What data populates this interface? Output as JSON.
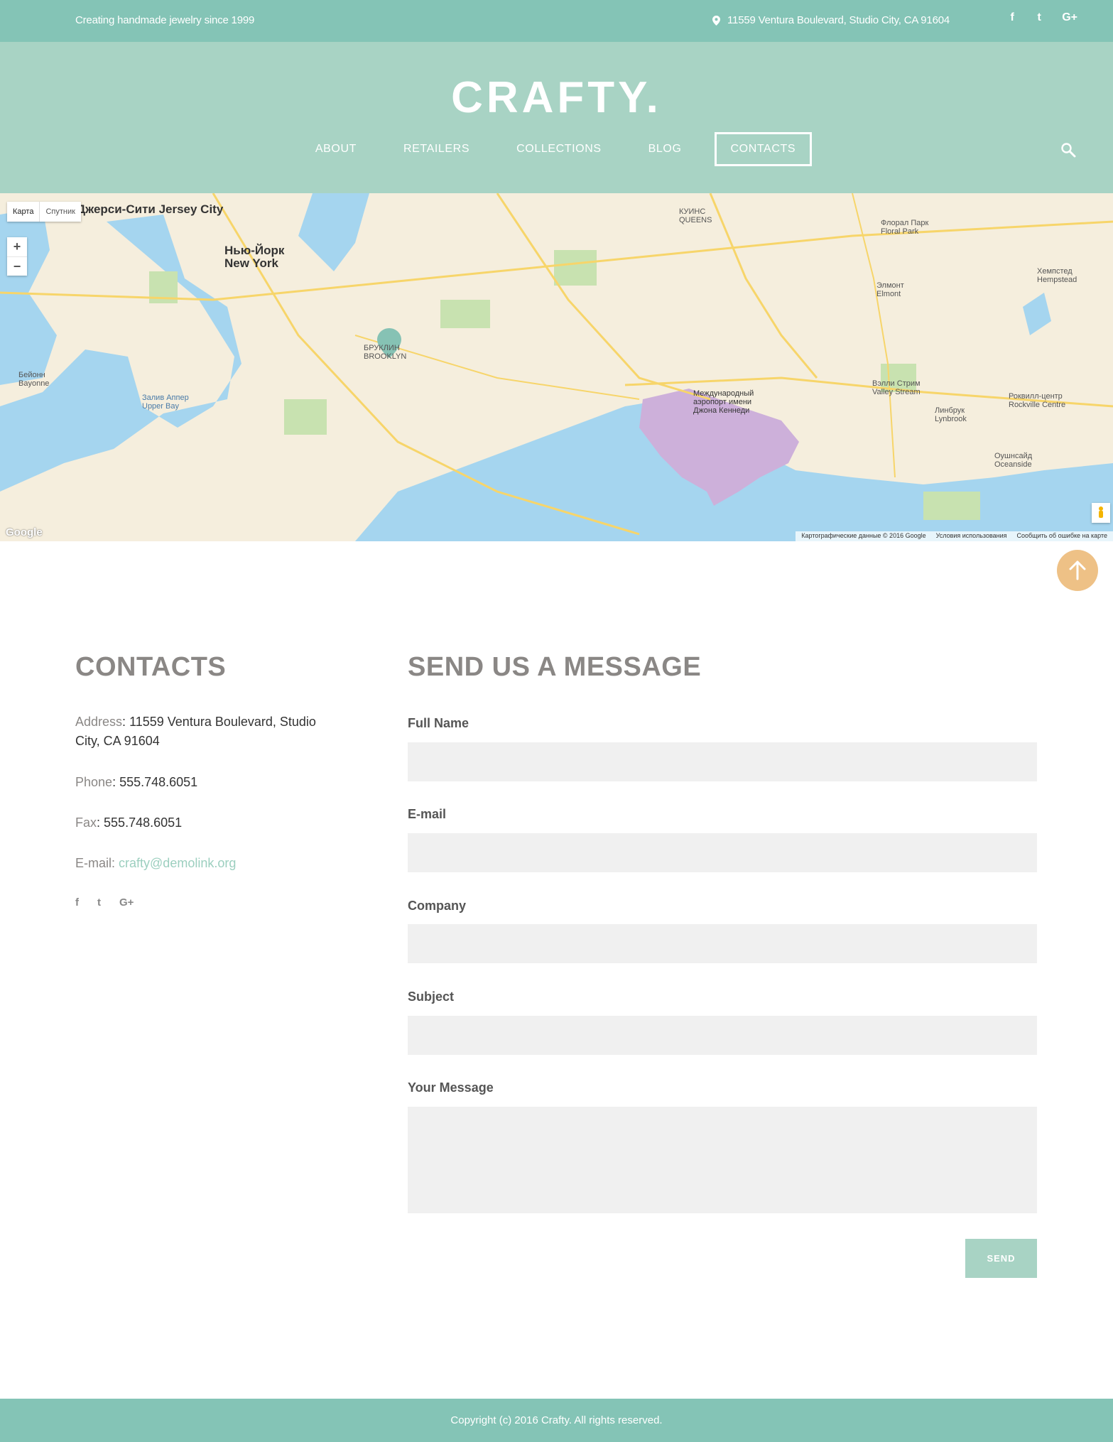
{
  "topbar": {
    "tagline": "Creating handmade jewelry since 1999",
    "address": "11559 Ventura Boulevard, Studio City, CA 91604",
    "social": [
      "f",
      "t",
      "G+"
    ]
  },
  "header": {
    "logo": "CRAFTY.",
    "nav": [
      "ABOUT",
      "RETAILERS",
      "COLLECTIONS",
      "BLOG",
      "CONTACTS"
    ],
    "active_nav": "CONTACTS"
  },
  "map": {
    "type_buttons": [
      "Карта",
      "Спутник"
    ],
    "zoom_in": "+",
    "zoom_out": "−",
    "labels": [
      "Джерси-Сити Jersey City",
      "Нью-Йорк New York",
      "БРУКЛИН BROOKLYN",
      "КУИНС QUEENS",
      "Бейонн Bayonne",
      "Залив Аппер Upper Bay",
      "Международный аэропорт имени Джона Кеннеди",
      "Флорал Парк Floral Park",
      "Элмонт Elmont",
      "Хемпстед Hempstead",
      "Вэлли Стрим Valley Stream",
      "Линбрук Lynbrook",
      "Роквилл-центр Rockville Centre",
      "Оушнсайд Oceanside"
    ],
    "google": "Google",
    "footer_links": [
      "Картографические данные © 2016 Google",
      "Условия использования",
      "Сообщить об ошибке на карте"
    ]
  },
  "contacts": {
    "title": "CONTACTS",
    "address_label": "Address",
    "address_value": "11559 Ventura Boulevard, Studio City, CA 91604",
    "phone_label": "Phone",
    "phone_value": "555.748.6051",
    "fax_label": "Fax",
    "fax_value": "555.748.6051",
    "email_label": "E-mail:",
    "email_value": "crafty@demolink.org",
    "social": [
      "f",
      "t",
      "G+"
    ]
  },
  "form": {
    "title": "SEND US A MESSAGE",
    "full_name_label": "Full Name",
    "email_label": "E-mail",
    "company_label": "Company",
    "subject_label": "Subject",
    "message_label": "Your Message",
    "send_label": "SEND"
  },
  "footer": {
    "copyright": "Copyright (c) 2016 Crafty. All rights reserved."
  },
  "colors": {
    "topbar": "#84c4b6",
    "header": "#a8d3c4",
    "accent_orange": "#eec186",
    "heading_gray": "#8a8785"
  },
  "icons": {
    "address": "map-pin-icon",
    "search": "search-icon",
    "to_top": "arrow-up-icon"
  }
}
